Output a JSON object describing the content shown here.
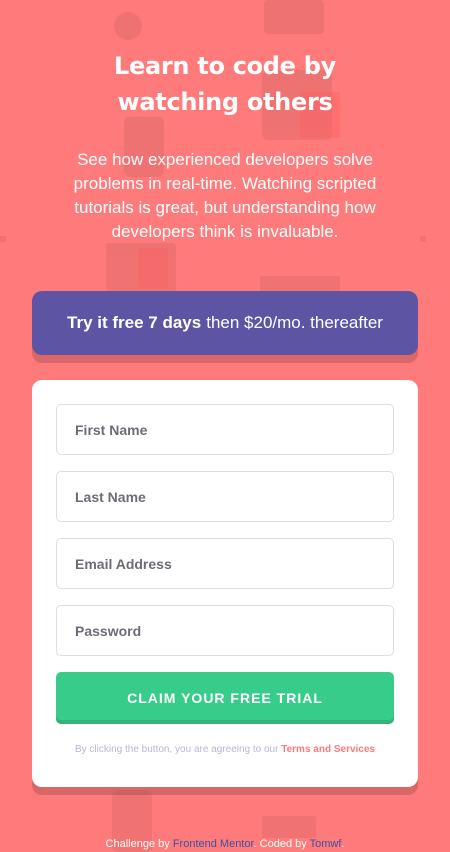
{
  "hero": {
    "title": "Learn to code by watching others",
    "description": "See how experienced developers solve problems in real-time. Watching scripted tutorials is great, but understanding how developers think is invaluable."
  },
  "promo": {
    "bold": "Try it free 7 days",
    "rest": "then $20/mo. thereafter"
  },
  "form": {
    "first_name_placeholder": "First Name",
    "last_name_placeholder": "Last Name",
    "email_placeholder": "Email Address",
    "password_placeholder": "Password",
    "submit_label": "CLAIM YOUR FREE TRIAL",
    "terms_prefix": "By clicking the button, you are agreeing to our",
    "terms_link": "Terms and Services"
  },
  "footer": {
    "challenge_prefix": "Challenge by",
    "challenge_link": "Frontend Mentor",
    "coded_prefix": ". Coded by",
    "coded_link": "Tomwf",
    "suffix": "."
  },
  "colors": {
    "background": "#ff7a7a",
    "promo": "#5e54a4",
    "cta": "#38cc8b",
    "terms_link": "#ff7a7a",
    "footer_link": "#3e52a3"
  }
}
